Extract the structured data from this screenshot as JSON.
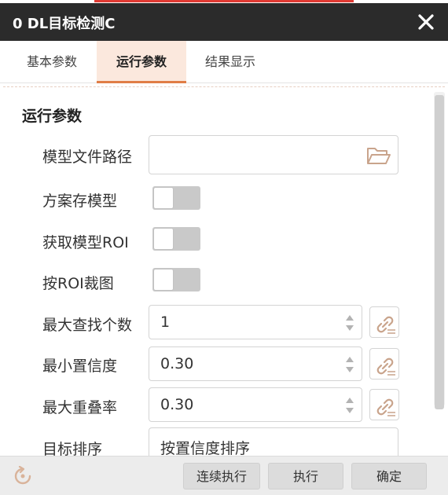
{
  "window": {
    "title": "0 DL目标检测C"
  },
  "tabs": [
    {
      "label": "基本参数",
      "active": false
    },
    {
      "label": "运行参数",
      "active": true
    },
    {
      "label": "结果显示",
      "active": false
    }
  ],
  "section": {
    "title": "运行参数"
  },
  "fields": {
    "model_path": {
      "label": "模型文件路径",
      "value": ""
    },
    "save_model": {
      "label": "方案存模型",
      "on": false
    },
    "get_model_roi": {
      "label": "获取模型ROI",
      "on": false
    },
    "crop_by_roi": {
      "label": "按ROI裁图",
      "on": false
    },
    "max_find_count": {
      "label": "最大查找个数",
      "value": "1"
    },
    "min_confidence": {
      "label": "最小置信度",
      "value": "0.30"
    },
    "max_overlap": {
      "label": "最大重叠率",
      "value": "0.30"
    },
    "target_sort": {
      "label": "目标排序",
      "value": "按置信度排序"
    }
  },
  "footer": {
    "continuous_label": "连续执行",
    "execute_label": "执行",
    "confirm_label": "确定"
  },
  "colors": {
    "titlebar": "#2b2b2b",
    "accent": "#e07d46",
    "active_tab_bg": "#fbe8dd",
    "icon": "#c9a48c"
  }
}
